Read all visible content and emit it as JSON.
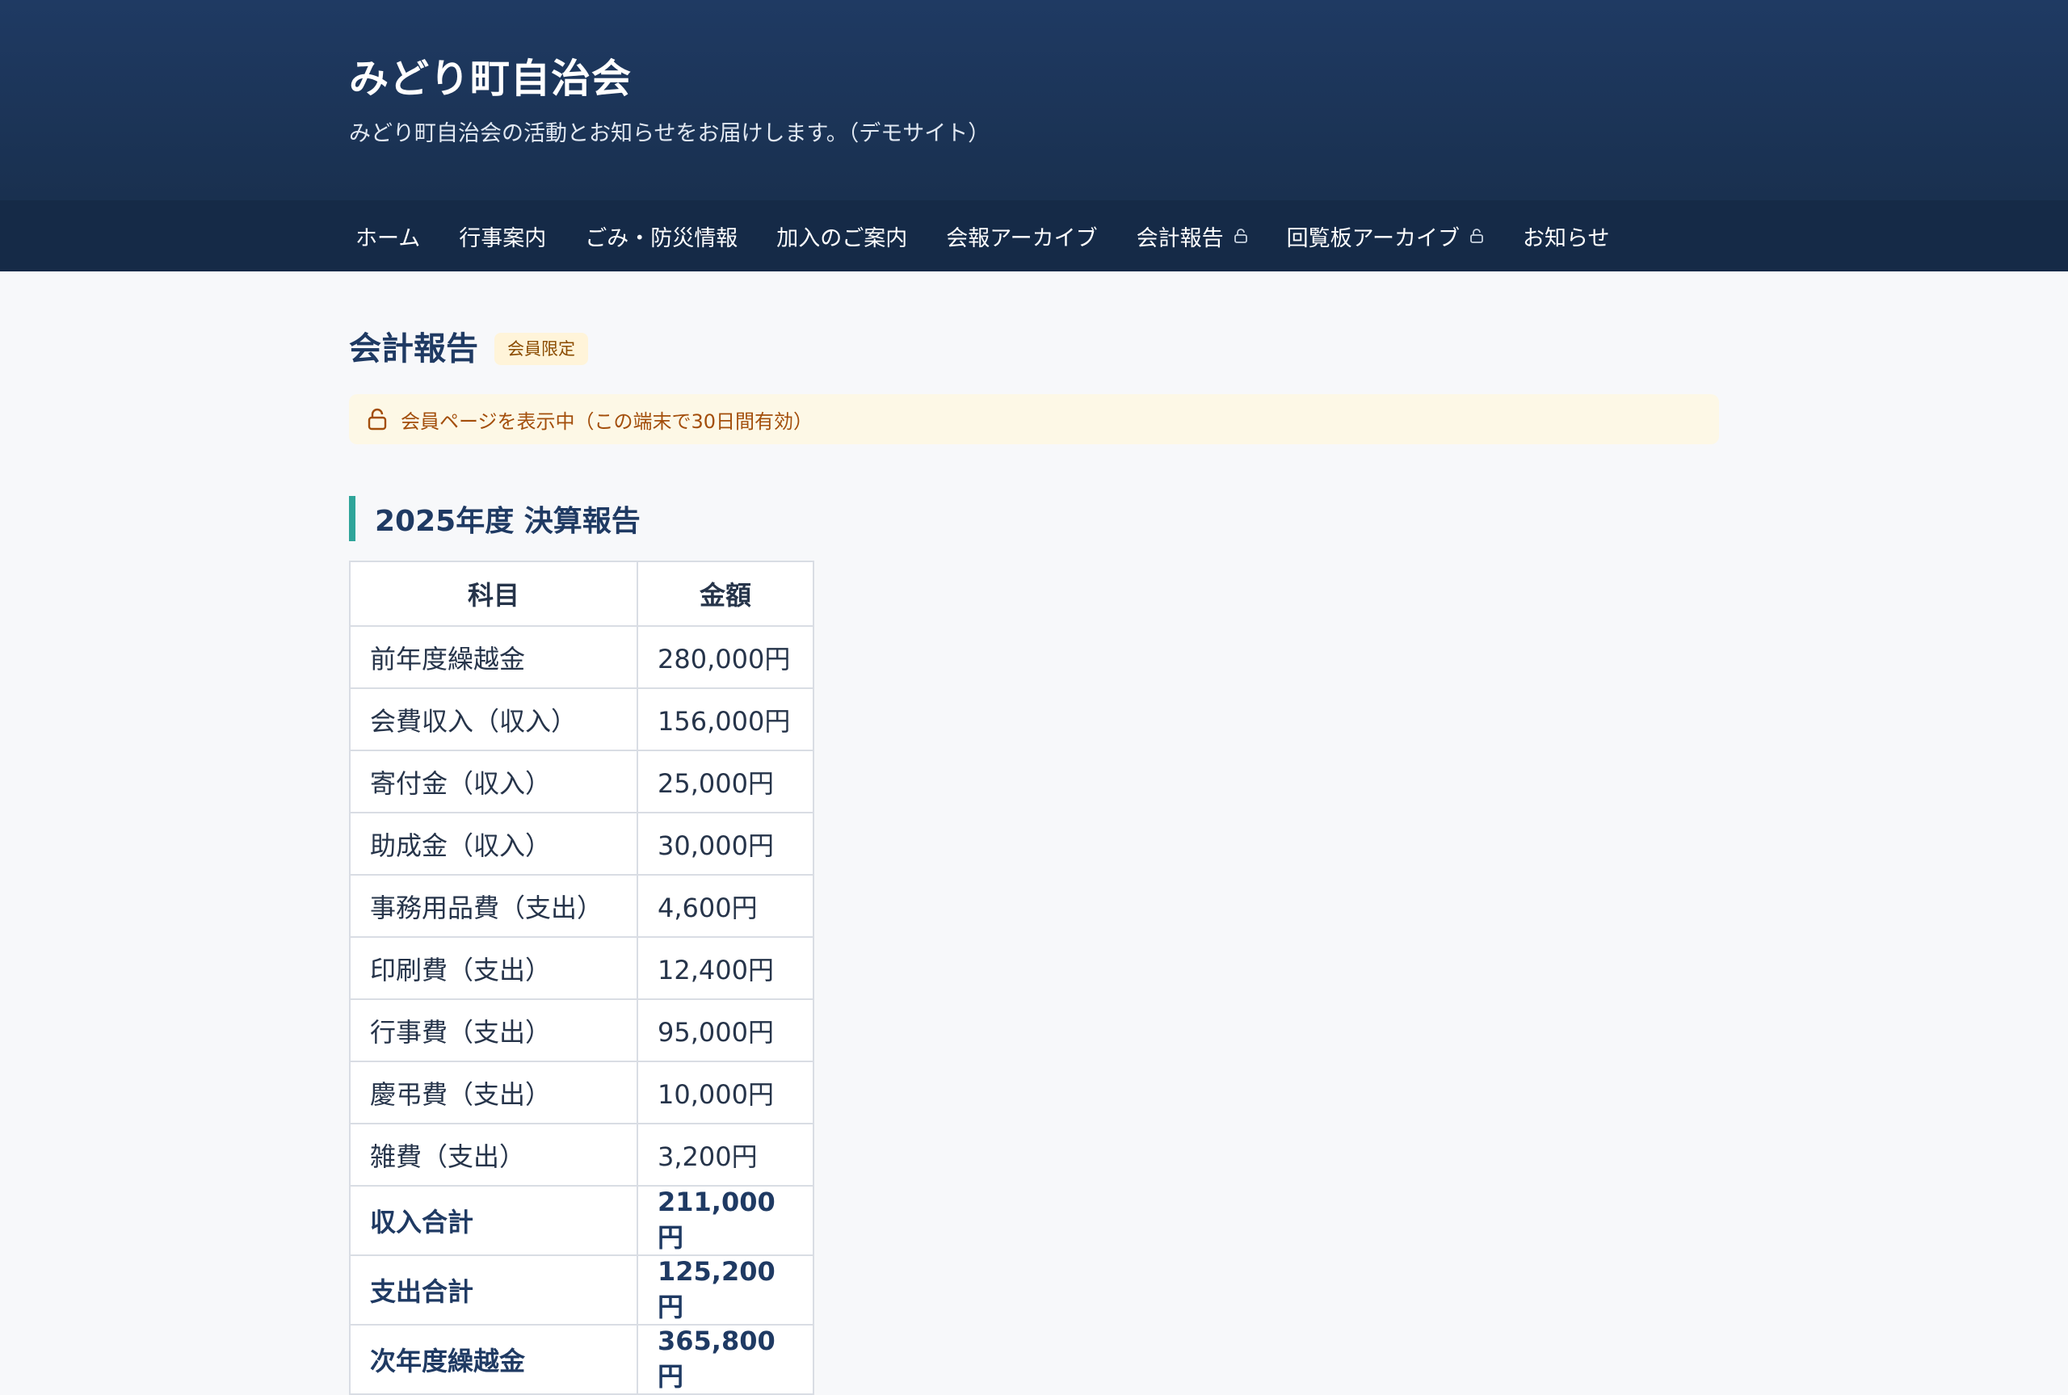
{
  "header": {
    "title": "みどり町自治会",
    "tagline": "みどり町自治会の活動とお知らせをお届けします。（デモサイト）"
  },
  "nav": {
    "items": [
      {
        "label": "ホーム",
        "locked": false
      },
      {
        "label": "行事案内",
        "locked": false
      },
      {
        "label": "ごみ・防災情報",
        "locked": false
      },
      {
        "label": "加入のご案内",
        "locked": false
      },
      {
        "label": "会報アーカイブ",
        "locked": false
      },
      {
        "label": "会計報告",
        "locked": true
      },
      {
        "label": "回覧板アーカイブ",
        "locked": true
      },
      {
        "label": "お知らせ",
        "locked": false
      }
    ]
  },
  "page": {
    "title": "会計報告",
    "badge": "会員限定",
    "notice": "会員ページを表示中（この端末で30日間有効）"
  },
  "section": {
    "title": "2025年度 決算報告"
  },
  "table": {
    "headers": [
      "科目",
      "金額"
    ],
    "rows": [
      {
        "subject": "前年度繰越金",
        "amount": "280,000円",
        "total": false
      },
      {
        "subject": "会費収入（収入）",
        "amount": "156,000円",
        "total": false
      },
      {
        "subject": "寄付金（収入）",
        "amount": "25,000円",
        "total": false
      },
      {
        "subject": "助成金（収入）",
        "amount": "30,000円",
        "total": false
      },
      {
        "subject": "事務用品費（支出）",
        "amount": "4,600円",
        "total": false
      },
      {
        "subject": "印刷費（支出）",
        "amount": "12,400円",
        "total": false
      },
      {
        "subject": "行事費（支出）",
        "amount": "95,000円",
        "total": false
      },
      {
        "subject": "慶弔費（支出）",
        "amount": "10,000円",
        "total": false
      },
      {
        "subject": "雑費（支出）",
        "amount": "3,200円",
        "total": false
      },
      {
        "subject": "収入合計",
        "amount": "211,000円",
        "total": true
      },
      {
        "subject": "支出合計",
        "amount": "125,200円",
        "total": true
      },
      {
        "subject": "次年度繰越金",
        "amount": "365,800円",
        "total": true
      }
    ]
  },
  "colors": {
    "header_bg": "#1f3a63",
    "nav_bg": "#152a47",
    "accent": "#2fa59a",
    "badge_bg": "#fff4d9",
    "notice_bg": "#fdf8e6",
    "notice_text": "#a34e0b"
  },
  "icons": {
    "lock": "lock-icon"
  }
}
